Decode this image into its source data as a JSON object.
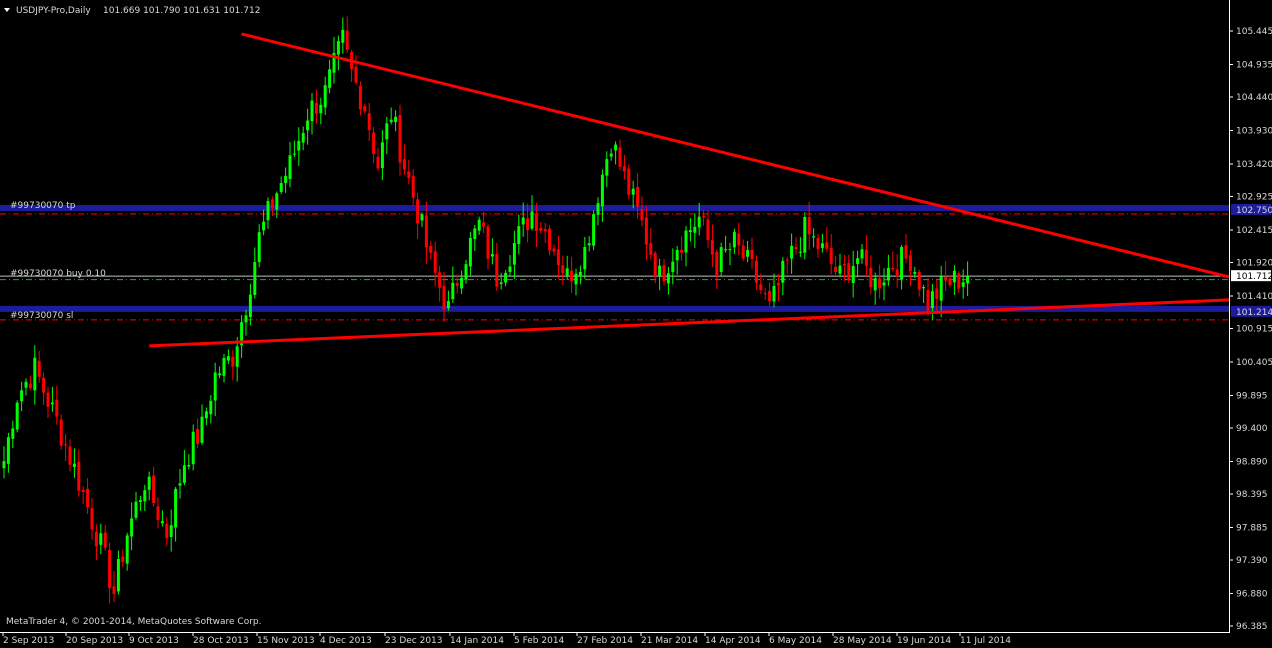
{
  "window": {
    "symbol_title": "USDJPY-Pro,Daily",
    "ohlc": "101.669 101.790 101.631 101.712",
    "copyright": "MetaTrader 4, © 2001-2014, MetaQuotes Software Corp."
  },
  "colors": {
    "background": "#000000",
    "axis": "#ffffff",
    "bull_candle": "#00ff00",
    "bear_candle": "#ff0000",
    "trendline": "#ff0000",
    "order_level": "#1c1c9c",
    "order_dash": "#ff0000",
    "price_line": "#c0c0c0",
    "entry_dash": "#00c800"
  },
  "orders": {
    "tp": {
      "label": "#99730070 tp",
      "price": 102.75,
      "tag": "102.750"
    },
    "buy": {
      "label": "#99730070 buy 0.10",
      "price": 101.66
    },
    "sl": {
      "label": "#99730070 sl",
      "price": 101.214,
      "tag": "101.214"
    }
  },
  "current_price": {
    "value": 101.712,
    "tag": "101.712"
  },
  "chart_data": {
    "type": "candlestick",
    "ylim": [
      96.38,
      105.65
    ],
    "y_ticks": [
      "105.445",
      "104.935",
      "104.440",
      "103.930",
      "103.420",
      "102.925",
      "102.415",
      "101.920",
      "101.410",
      "100.915",
      "100.405",
      "99.895",
      "99.400",
      "98.890",
      "98.395",
      "97.885",
      "97.390",
      "96.880",
      "96.385"
    ],
    "x_ticks": [
      "2 Sep 2013",
      "20 Sep 2013",
      "9 Oct 2013",
      "28 Oct 2013",
      "15 Nov 2013",
      "4 Dec 2013",
      "23 Dec 2013",
      "14 Jan 2014",
      "5 Feb 2014",
      "27 Feb 2014",
      "21 Mar 2014",
      "14 Apr 2014",
      "6 May 2014",
      "28 May 2014",
      "19 Jun 2014",
      "11 Jul 2014"
    ],
    "trendlines": [
      {
        "name": "upper",
        "from": [
          54,
          105.4
        ],
        "to": [
          232,
          101.7
        ]
      },
      {
        "name": "lower",
        "from": [
          33,
          100.65
        ],
        "to": [
          232,
          101.35
        ]
      }
    ],
    "close_anchors": [
      [
        0,
        98.9
      ],
      [
        3,
        99.9
      ],
      [
        7,
        100.3
      ],
      [
        12,
        99.5
      ],
      [
        17,
        98.6
      ],
      [
        22,
        97.6
      ],
      [
        25,
        96.9
      ],
      [
        28,
        97.8
      ],
      [
        32,
        98.6
      ],
      [
        37,
        97.8
      ],
      [
        41,
        98.9
      ],
      [
        45,
        99.4
      ],
      [
        48,
        100.2
      ],
      [
        52,
        100.5
      ],
      [
        55,
        101.3
      ],
      [
        58,
        102.3
      ],
      [
        62,
        103.0
      ],
      [
        65,
        103.4
      ],
      [
        69,
        104.2
      ],
      [
        73,
        104.5
      ],
      [
        77,
        105.3
      ],
      [
        79,
        104.8
      ],
      [
        82,
        104.3
      ],
      [
        85,
        103.4
      ],
      [
        88,
        104.2
      ],
      [
        91,
        103.4
      ],
      [
        94,
        102.7
      ],
      [
        97,
        101.9
      ],
      [
        101,
        101.2
      ],
      [
        104,
        101.9
      ],
      [
        108,
        102.5
      ],
      [
        112,
        101.7
      ],
      [
        116,
        102.2
      ],
      [
        120,
        102.7
      ],
      [
        124,
        102.3
      ],
      [
        128,
        101.7
      ],
      [
        132,
        102.1
      ],
      [
        135,
        103.0
      ],
      [
        138,
        103.8
      ],
      [
        141,
        103.2
      ],
      [
        145,
        102.5
      ],
      [
        149,
        101.7
      ],
      [
        153,
        102.2
      ],
      [
        158,
        102.6
      ],
      [
        162,
        101.9
      ],
      [
        166,
        102.2
      ],
      [
        170,
        101.8
      ],
      [
        174,
        101.2
      ],
      [
        178,
        101.9
      ],
      [
        182,
        102.4
      ],
      [
        186,
        102.1
      ],
      [
        190,
        101.7
      ],
      [
        194,
        102.0
      ],
      [
        198,
        101.6
      ],
      [
        202,
        101.9
      ],
      [
        206,
        102.0
      ],
      [
        210,
        101.3
      ],
      [
        214,
        101.6
      ],
      [
        219,
        101.712
      ]
    ]
  }
}
